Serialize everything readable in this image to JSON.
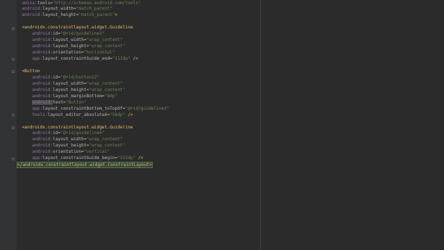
{
  "colors": {
    "background": "#2b2b2b",
    "gutter": "#313335",
    "tag": "#e8bf6a",
    "namespace": "#9876aa",
    "attribute": "#bababa",
    "value": "#6a8759"
  },
  "lines": [
    {
      "indent": "  ",
      "tokens": [
        {
          "t": "ns",
          "v": "xmlns:"
        },
        {
          "t": "attr",
          "v": "tools"
        },
        {
          "t": "punct",
          "v": "="
        },
        {
          "t": "val",
          "v": "\"http://schemas.android.com/tools\""
        }
      ]
    },
    {
      "indent": "  ",
      "tokens": [
        {
          "t": "ns",
          "v": "android:"
        },
        {
          "t": "attr",
          "v": "layout_width"
        },
        {
          "t": "punct",
          "v": "="
        },
        {
          "t": "val",
          "v": "\"match_parent\""
        }
      ]
    },
    {
      "indent": "  ",
      "tokens": [
        {
          "t": "ns",
          "v": "android:"
        },
        {
          "t": "attr",
          "v": "layout_height"
        },
        {
          "t": "punct",
          "v": "="
        },
        {
          "t": "val",
          "v": "\"match_parent\""
        },
        {
          "t": "tag",
          "v": ">"
        }
      ]
    },
    {
      "indent": "",
      "tokens": []
    },
    {
      "indent": "  ",
      "fold": "start",
      "tokens": [
        {
          "t": "tag",
          "v": "<androidx.constraintlayout.widget.Guideline"
        }
      ]
    },
    {
      "indent": "      ",
      "tokens": [
        {
          "t": "ns",
          "v": "android:"
        },
        {
          "t": "attr",
          "v": "id"
        },
        {
          "t": "punct",
          "v": "="
        },
        {
          "t": "val",
          "v": "\"@+id/guideline3\""
        }
      ]
    },
    {
      "indent": "      ",
      "tokens": [
        {
          "t": "ns",
          "v": "android:"
        },
        {
          "t": "attr",
          "v": "layout_width"
        },
        {
          "t": "punct",
          "v": "="
        },
        {
          "t": "val",
          "v": "\"wrap_content\""
        }
      ]
    },
    {
      "indent": "      ",
      "tokens": [
        {
          "t": "ns",
          "v": "android:"
        },
        {
          "t": "attr",
          "v": "layout_height"
        },
        {
          "t": "punct",
          "v": "="
        },
        {
          "t": "val",
          "v": "\"wrap_content\""
        }
      ]
    },
    {
      "indent": "      ",
      "tokens": [
        {
          "t": "ns",
          "v": "android:"
        },
        {
          "t": "attr",
          "v": "orientation"
        },
        {
          "t": "punct",
          "v": "="
        },
        {
          "t": "val",
          "v": "\"horizontal\""
        }
      ]
    },
    {
      "indent": "      ",
      "fold": "end",
      "tokens": [
        {
          "t": "ns",
          "v": "app:"
        },
        {
          "t": "attr",
          "v": "layout_constraintGuide_end"
        },
        {
          "t": "punct",
          "v": "="
        },
        {
          "t": "val",
          "v": "\"112dp\""
        },
        {
          "t": "tag",
          "v": " />"
        }
      ]
    },
    {
      "indent": "",
      "tokens": []
    },
    {
      "indent": "  ",
      "fold": "start",
      "tokens": [
        {
          "t": "tag",
          "v": "<Button"
        }
      ]
    },
    {
      "indent": "      ",
      "tokens": [
        {
          "t": "ns",
          "v": "android:"
        },
        {
          "t": "attr",
          "v": "id"
        },
        {
          "t": "punct",
          "v": "="
        },
        {
          "t": "val",
          "v": "\"@+id/button12\""
        }
      ]
    },
    {
      "indent": "      ",
      "tokens": [
        {
          "t": "ns",
          "v": "android:"
        },
        {
          "t": "attr",
          "v": "layout_width"
        },
        {
          "t": "punct",
          "v": "="
        },
        {
          "t": "val",
          "v": "\"wrap_content\""
        }
      ]
    },
    {
      "indent": "      ",
      "tokens": [
        {
          "t": "ns",
          "v": "android:"
        },
        {
          "t": "attr",
          "v": "layout_height"
        },
        {
          "t": "punct",
          "v": "="
        },
        {
          "t": "val",
          "v": "\"wrap_content\""
        }
      ]
    },
    {
      "indent": "      ",
      "tokens": [
        {
          "t": "ns",
          "v": "android:"
        },
        {
          "t": "attr",
          "v": "layout_marginBottom"
        },
        {
          "t": "punct",
          "v": "="
        },
        {
          "t": "val",
          "v": "\"8dp\""
        }
      ]
    },
    {
      "indent": "      ",
      "tokens": [
        {
          "t": "ns-hl",
          "v": "android:"
        },
        {
          "t": "attr",
          "v": "text"
        },
        {
          "t": "punct",
          "v": "="
        },
        {
          "t": "val",
          "v": "\"Button\""
        }
      ]
    },
    {
      "indent": "      ",
      "tokens": [
        {
          "t": "ns",
          "v": "app:"
        },
        {
          "t": "attr",
          "v": "layout_constraintBottom_toTopOf"
        },
        {
          "t": "punct",
          "v": "="
        },
        {
          "t": "val",
          "v": "\"@+id/guideline3\""
        }
      ]
    },
    {
      "indent": "      ",
      "fold": "end",
      "tokens": [
        {
          "t": "ns",
          "v": "tools:"
        },
        {
          "t": "attr",
          "v": "layout_editor_absoluteX"
        },
        {
          "t": "punct",
          "v": "="
        },
        {
          "t": "val",
          "v": "\"56dp\""
        },
        {
          "t": "tag",
          "v": " />"
        }
      ]
    },
    {
      "indent": "",
      "tokens": []
    },
    {
      "indent": "  ",
      "fold": "start",
      "tokens": [
        {
          "t": "tag",
          "v": "<androidx.constraintlayout.widget.Guideline"
        }
      ]
    },
    {
      "indent": "      ",
      "tokens": [
        {
          "t": "ns",
          "v": "android:"
        },
        {
          "t": "attr",
          "v": "id"
        },
        {
          "t": "punct",
          "v": "="
        },
        {
          "t": "val",
          "v": "\"@+id/guideline4\""
        }
      ]
    },
    {
      "indent": "      ",
      "tokens": [
        {
          "t": "ns",
          "v": "android:"
        },
        {
          "t": "attr",
          "v": "layout_width"
        },
        {
          "t": "punct",
          "v": "="
        },
        {
          "t": "val",
          "v": "\"wrap_content\""
        }
      ]
    },
    {
      "indent": "      ",
      "tokens": [
        {
          "t": "ns",
          "v": "android:"
        },
        {
          "t": "attr",
          "v": "layout_height"
        },
        {
          "t": "punct",
          "v": "="
        },
        {
          "t": "val",
          "v": "\"wrap_content\""
        }
      ]
    },
    {
      "indent": "      ",
      "tokens": [
        {
          "t": "ns",
          "v": "android:"
        },
        {
          "t": "attr",
          "v": "orientation"
        },
        {
          "t": "punct",
          "v": "="
        },
        {
          "t": "val",
          "v": "\"vertical\""
        }
      ]
    },
    {
      "indent": "      ",
      "fold": "end",
      "caret_after": 0,
      "tokens": [
        {
          "t": "ns",
          "v": "app:"
        },
        {
          "t": "attr",
          "v": "layout_constraintGuide_begin"
        },
        {
          "t": "punct",
          "v": "="
        },
        {
          "t": "val",
          "v": "\"332dp\""
        },
        {
          "t": "tag",
          "v": " />"
        }
      ]
    },
    {
      "indent": "",
      "highlight": true,
      "tokens": [
        {
          "t": "tag",
          "v": "</androidx.constraintlayout.widget.ConstraintLayout>"
        }
      ]
    }
  ]
}
